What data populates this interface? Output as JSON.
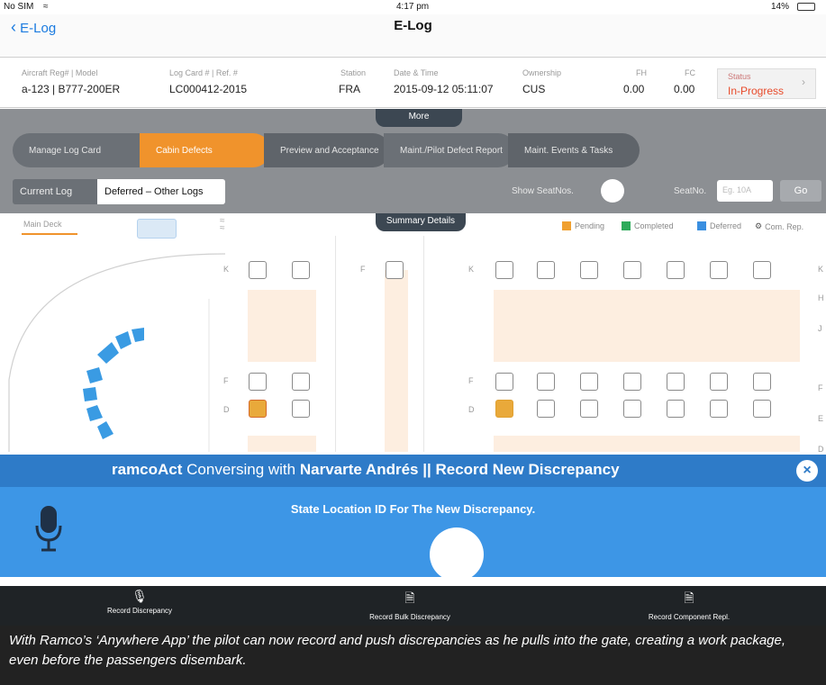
{
  "status_bar": {
    "carrier": "No SIM",
    "time": "4:17 pm",
    "battery": "14%"
  },
  "nav": {
    "back_label": "E-Log",
    "title": "E-Log"
  },
  "info": {
    "aircraft_label": "Aircraft Reg# | Model",
    "aircraft_value": "a-123 | B777-200ER",
    "logcard_label": "Log Card # | Ref. #",
    "logcard_value": "LC000412-2015",
    "station_label": "Station",
    "station_value": "FRA",
    "datetime_label": "Date & Time",
    "datetime_value": "2015-09-12 05:11:07",
    "ownership_label": "Ownership",
    "ownership_value": "CUS",
    "fh_label": "FH",
    "fh_value": "0.00",
    "fc_label": "FC",
    "fc_value": "0.00",
    "status_label": "Status",
    "status_value": "In-Progress"
  },
  "more_label": "More",
  "steps": [
    {
      "label": "Manage Log Card",
      "active": false
    },
    {
      "label": "Cabin Defects",
      "active": true
    },
    {
      "label": "Preview and Acceptance",
      "active": false
    },
    {
      "label": "Maint./Pilot Defect Report",
      "active": false
    },
    {
      "label": "Maint. Events & Tasks",
      "active": false
    }
  ],
  "log_tabs": {
    "current": "Current Log",
    "deferred": "Deferred – Other Logs"
  },
  "show_seat_nos": "Show SeatNos.",
  "seat_no_label": "SeatNo.",
  "seat_no_placeholder": "Eg. 10A",
  "go_label": "Go",
  "deck_tab": "Main Deck",
  "summary_label": "Summary Details",
  "legend": {
    "pending": "Pending",
    "completed": "Completed",
    "deferred": "Deferred",
    "comp_rep": "Com. Rep.",
    "colors": {
      "pending": "#f0a030",
      "completed": "#2eab5b",
      "deferred": "#3a8fe0"
    }
  },
  "row_labels": {
    "k": "K",
    "f": "F",
    "d": "D",
    "h": "H",
    "j": "J",
    "e": "E"
  },
  "assistant": {
    "app": "ramcoAct",
    "conversing": "Conversing with",
    "user": "Narvarte Andrés",
    "context": "|| Record New Discrepancy",
    "prompt": "State Location ID For The New Discrepancy."
  },
  "bottom_bar": {
    "record_discrepancy": "Record Discrepancy",
    "record_bulk": "Record Bulk Discrepancy",
    "record_component": "Record Component Repl."
  },
  "caption": "With Ramco’s ‘Anywhere App’ the pilot can now record and push discrepancies as he pulls into the gate, creating a work package, even before the passengers disembark."
}
